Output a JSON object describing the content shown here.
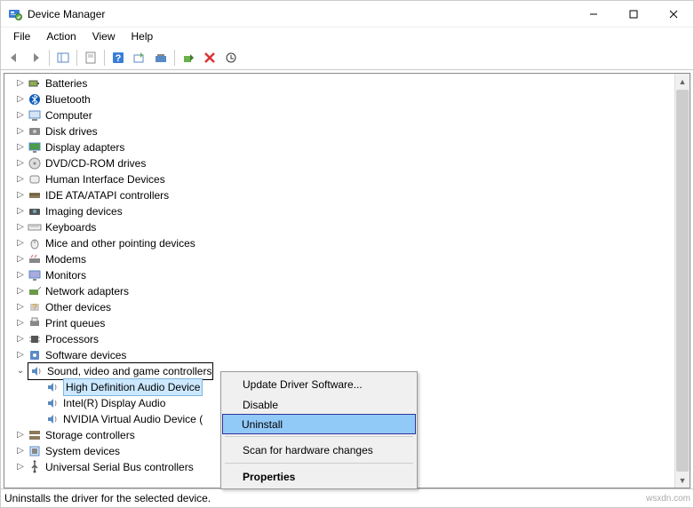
{
  "window": {
    "title": "Device Manager"
  },
  "menu": {
    "file": "File",
    "action": "Action",
    "view": "View",
    "help": "Help"
  },
  "tree": {
    "items": [
      {
        "label": "Batteries",
        "exp": "▷"
      },
      {
        "label": "Bluetooth",
        "exp": "▷"
      },
      {
        "label": "Computer",
        "exp": "▷"
      },
      {
        "label": "Disk drives",
        "exp": "▷"
      },
      {
        "label": "Display adapters",
        "exp": "▷"
      },
      {
        "label": "DVD/CD-ROM drives",
        "exp": "▷"
      },
      {
        "label": "Human Interface Devices",
        "exp": "▷"
      },
      {
        "label": "IDE ATA/ATAPI controllers",
        "exp": "▷"
      },
      {
        "label": "Imaging devices",
        "exp": "▷"
      },
      {
        "label": "Keyboards",
        "exp": "▷"
      },
      {
        "label": "Mice and other pointing devices",
        "exp": "▷"
      },
      {
        "label": "Modems",
        "exp": "▷"
      },
      {
        "label": "Monitors",
        "exp": "▷"
      },
      {
        "label": "Network adapters",
        "exp": "▷"
      },
      {
        "label": "Other devices",
        "exp": "▷"
      },
      {
        "label": "Print queues",
        "exp": "▷"
      },
      {
        "label": "Processors",
        "exp": "▷"
      },
      {
        "label": "Software devices",
        "exp": "▷"
      }
    ],
    "selected_category": {
      "label": "Sound, video and game controllers",
      "exp": "⌄"
    },
    "children": [
      {
        "label": "High Definition Audio Device"
      },
      {
        "label": "Intel(R) Display Audio"
      },
      {
        "label": "NVIDIA Virtual Audio Device ("
      }
    ],
    "after": [
      {
        "label": "Storage controllers",
        "exp": "▷"
      },
      {
        "label": "System devices",
        "exp": "▷"
      },
      {
        "label": "Universal Serial Bus controllers",
        "exp": "▷"
      }
    ]
  },
  "context": {
    "update": "Update Driver Software...",
    "disable": "Disable",
    "uninstall": "Uninstall",
    "scan": "Scan for hardware changes",
    "properties": "Properties"
  },
  "status": {
    "text": "Uninstalls the driver for the selected device.",
    "watermark": "wsxdn.com"
  }
}
